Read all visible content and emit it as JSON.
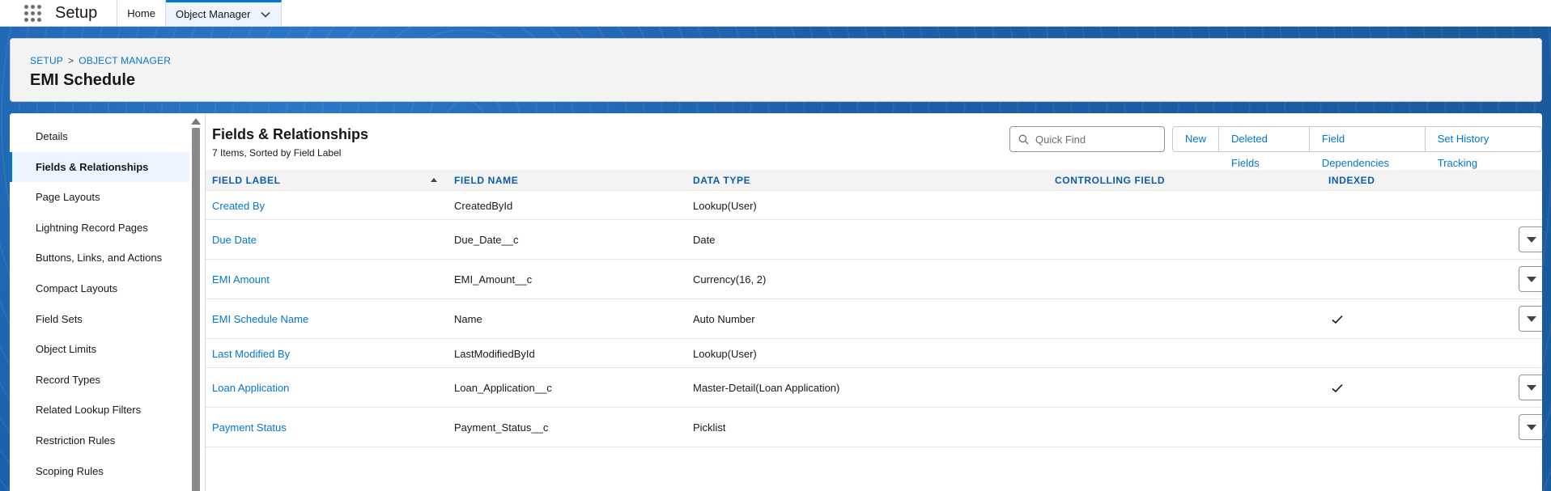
{
  "header": {
    "app_name": "Setup",
    "tabs": [
      {
        "label": "Home"
      },
      {
        "label": "Object Manager"
      }
    ]
  },
  "page": {
    "breadcrumb": [
      "SETUP",
      "OBJECT MANAGER"
    ],
    "breadcrumb_sep": ">",
    "title": "EMI Schedule"
  },
  "sidebar": {
    "items": [
      {
        "label": "Details"
      },
      {
        "label": "Fields & Relationships"
      },
      {
        "label": "Page Layouts"
      },
      {
        "label": "Lightning Record Pages"
      },
      {
        "label": "Buttons, Links, and Actions"
      },
      {
        "label": "Compact Layouts"
      },
      {
        "label": "Field Sets"
      },
      {
        "label": "Object Limits"
      },
      {
        "label": "Record Types"
      },
      {
        "label": "Related Lookup Filters"
      },
      {
        "label": "Restriction Rules"
      },
      {
        "label": "Scoping Rules"
      }
    ],
    "active_index": 1
  },
  "main": {
    "title": "Fields & Relationships",
    "subtitle": "7 Items, Sorted by Field Label",
    "search_placeholder": "Quick Find",
    "buttons": [
      {
        "label": "New"
      },
      {
        "label": "Deleted Fields"
      },
      {
        "label": "Field Dependencies"
      },
      {
        "label": "Set History Tracking"
      }
    ]
  },
  "table": {
    "columns": [
      "FIELD LABEL",
      "FIELD NAME",
      "DATA TYPE",
      "CONTROLLING FIELD",
      "INDEXED"
    ],
    "rows": [
      {
        "label": "Created By",
        "name": "CreatedById",
        "type": "Lookup(User)",
        "controlling": "",
        "indexed": false,
        "menu": false
      },
      {
        "label": "Due Date",
        "name": "Due_Date__c",
        "type": "Date",
        "controlling": "",
        "indexed": false,
        "menu": true
      },
      {
        "label": "EMI Amount",
        "name": "EMI_Amount__c",
        "type": "Currency(16, 2)",
        "controlling": "",
        "indexed": false,
        "menu": true
      },
      {
        "label": "EMI Schedule Name",
        "name": "Name",
        "type": "Auto Number",
        "controlling": "",
        "indexed": true,
        "menu": true
      },
      {
        "label": "Last Modified By",
        "name": "LastModifiedById",
        "type": "Lookup(User)",
        "controlling": "",
        "indexed": false,
        "menu": false
      },
      {
        "label": "Loan Application",
        "name": "Loan_Application__c",
        "type": "Master-Detail(Loan Application)",
        "controlling": "",
        "indexed": true,
        "menu": true
      },
      {
        "label": "Payment Status",
        "name": "Payment_Status__c",
        "type": "Picklist",
        "controlling": "",
        "indexed": false,
        "menu": true
      }
    ]
  },
  "colors": {
    "brand": "#0176d3",
    "header_link": "#0b5cab",
    "background_blue": "#1b5fa8"
  },
  "icons": [
    "app-launcher-icon",
    "chevron-down-icon",
    "search-icon",
    "checkmark-icon",
    "dropdown-triangle-icon",
    "sort-ascending-icon"
  ]
}
